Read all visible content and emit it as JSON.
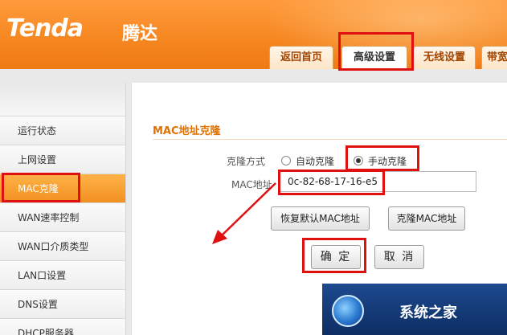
{
  "header": {
    "brand": "Tenda",
    "brand_cn": "腾达",
    "tabs": [
      "返回首页",
      "高级设置",
      "无线设置",
      "带宽"
    ]
  },
  "sidebar": {
    "items": [
      "运行状态",
      "上网设置",
      "MAC克隆",
      "WAN速率控制",
      "WAN口介质类型",
      "LAN口设置",
      "DNS设置",
      "DHCP服务器"
    ]
  },
  "main": {
    "section_title": "MAC地址克隆",
    "clone_mode_label": "克隆方式",
    "option_auto": "自动克隆",
    "option_manual": "手动克隆",
    "selected_option": "手动克隆",
    "mac_label": "MAC地址",
    "mac_value": "0c-82-68-17-16-e5",
    "restore_default_button": "恢复默认MAC地址",
    "clone_mac_button": "克隆MAC地址",
    "confirm_button": "确 定",
    "cancel_button": "取 消"
  },
  "watermark": {
    "text": "系统之家"
  },
  "colors": {
    "header_orange": "#f5861f",
    "highlight_red": "#e01010",
    "title_orange": "#e07000"
  }
}
